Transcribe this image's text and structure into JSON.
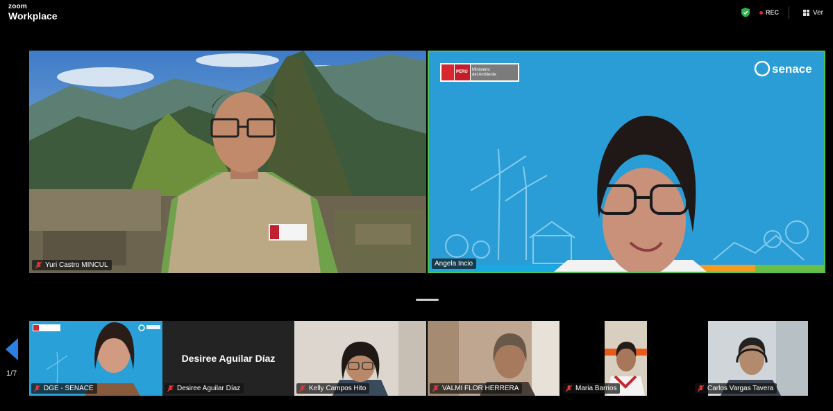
{
  "app": {
    "brand_small": "zoom",
    "brand_large": "Workplace"
  },
  "topbar": {
    "rec_label": "REC",
    "view_label": "Ver"
  },
  "colors": {
    "active_speaker_border": "#4ec24e",
    "rec_dot": "#e02828",
    "accent_blue": "#2a7fe0"
  },
  "main_tiles": [
    {
      "name": "Yuri Castro MINCUL",
      "muted": true,
      "video": "person in front of Machu Picchu virtual background"
    },
    {
      "name": "Angela Incio",
      "muted": false,
      "active_speaker": true,
      "background": {
        "ministry_flag": "PERÚ",
        "ministry_line1": "Ministerio",
        "ministry_line2": "del Ambiente",
        "logo_text": "senace"
      }
    }
  ],
  "pagination": {
    "page_label": "1/7"
  },
  "thumbnails": [
    {
      "name": "DGE - SENACE",
      "muted": true,
      "has_video": true
    },
    {
      "name": "Desiree Aguilar Díaz",
      "display_name": "Desiree Aguilar Díaz",
      "muted": true,
      "has_video": false
    },
    {
      "name": "Kelly Campos Hito",
      "muted": true,
      "has_video": true
    },
    {
      "name": "VALMI FLOR HERRERA",
      "muted": true,
      "has_video": true
    },
    {
      "name": "Maria Barrios",
      "muted": true,
      "has_video": true
    },
    {
      "name": "Carlos Vargas Tavera",
      "muted": true,
      "has_video": true
    }
  ]
}
